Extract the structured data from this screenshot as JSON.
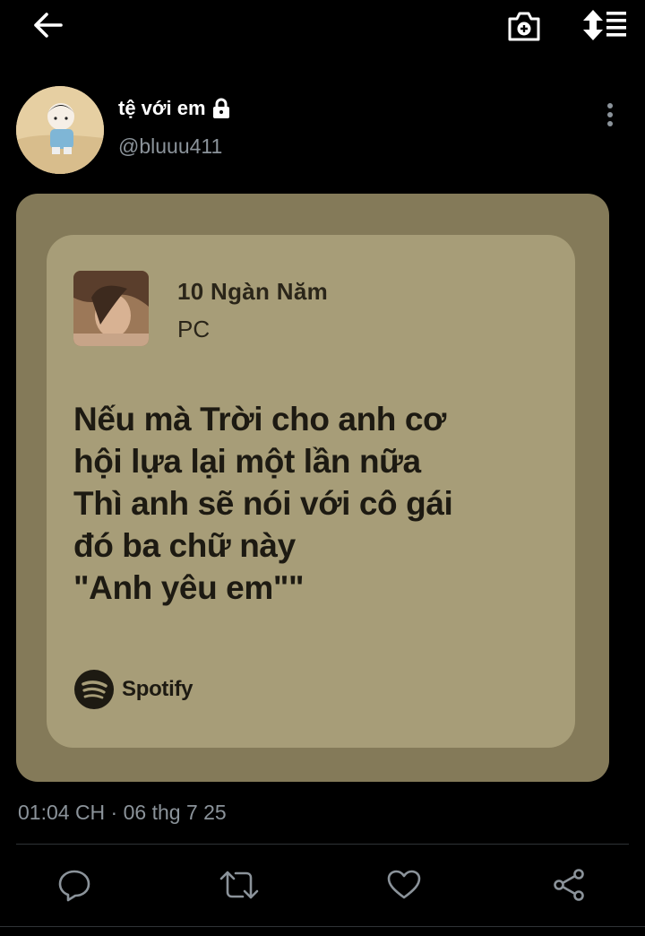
{
  "header": {
    "back_icon": "arrow-left-icon",
    "camera_icon": "camera-add-icon",
    "sort_icon": "sort-list-icon"
  },
  "tweet": {
    "display_name": "tệ với em",
    "locked_icon": "lock-icon",
    "handle": "@bluuu411",
    "more_icon": "more-vertical-icon",
    "timestamp": "01:04 CH · 06 thg 7 25"
  },
  "lyric_card": {
    "song_title": "10 Ngàn Năm",
    "artist": "PC",
    "lyrics": "Nếu mà Trời cho anh cơ\nhội lựa lại một lần nữa\nThì anh sẽ nói với cô gái\nđó ba chữ này\n\"Anh yêu em\"\"",
    "brand": "Spotify",
    "brand_icon": "spotify-logo-icon"
  },
  "actions": {
    "reply_icon": "reply-icon",
    "retweet_icon": "retweet-icon",
    "like_icon": "heart-icon",
    "share_icon": "share-icon"
  },
  "colors": {
    "background": "#000000",
    "media_frame": "#847a59",
    "card": "#a79d78",
    "secondary_text": "#8b939a"
  }
}
